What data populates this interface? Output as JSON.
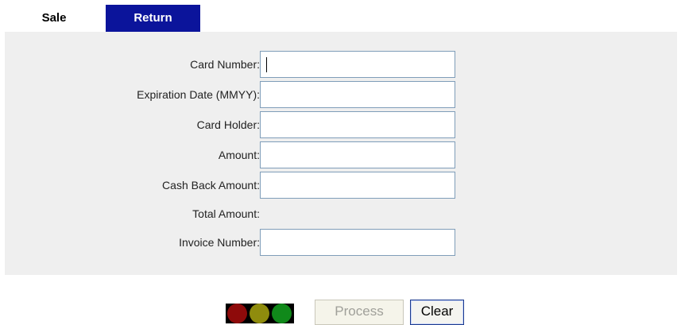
{
  "tabs": {
    "sale": "Sale",
    "return": "Return"
  },
  "form": {
    "card_number_label": "Card Number:",
    "card_number_value": "",
    "expiration_label": "Expiration Date (MMYY):",
    "expiration_value": "",
    "card_holder_label": "Card Holder:",
    "card_holder_value": "",
    "amount_label": "Amount:",
    "amount_value": "",
    "cash_back_label": "Cash Back Amount:",
    "cash_back_value": "",
    "total_amount_label": "Total Amount:",
    "total_amount_value": "",
    "invoice_label": "Invoice Number:",
    "invoice_value": ""
  },
  "status_lights": {
    "colors": [
      "#8e0a0a",
      "#8f8c0d",
      "#10891a"
    ]
  },
  "buttons": {
    "process": "Process",
    "clear": "Clear"
  }
}
